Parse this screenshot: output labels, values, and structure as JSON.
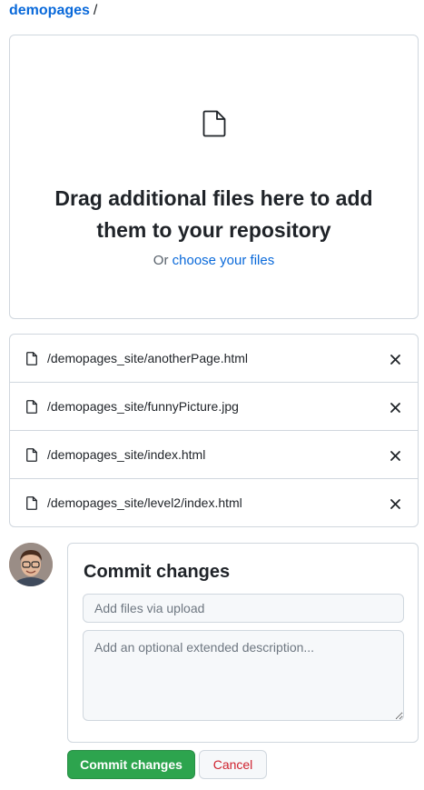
{
  "breadcrumb": {
    "repo": "demopages",
    "separator": "/"
  },
  "dropzone": {
    "title": "Drag additional files here to add them to your repository",
    "choose_prefix": "Or ",
    "choose_link": "choose your files",
    "icon": "file-icon"
  },
  "files": [
    {
      "name": "/demopages_site/anotherPage.html"
    },
    {
      "name": "/demopages_site/funnyPicture.jpg"
    },
    {
      "name": "/demopages_site/index.html"
    },
    {
      "name": "/demopages_site/level2/index.html"
    }
  ],
  "commit": {
    "heading": "Commit changes",
    "summary_placeholder": "Add files via upload",
    "description_placeholder": "Add an optional extended description...",
    "submit_label": "Commit changes",
    "cancel_label": "Cancel"
  },
  "colors": {
    "link": "#0969da",
    "primary_button": "#2da44e",
    "cancel_text": "#cf222e",
    "border": "#d0d7de"
  }
}
